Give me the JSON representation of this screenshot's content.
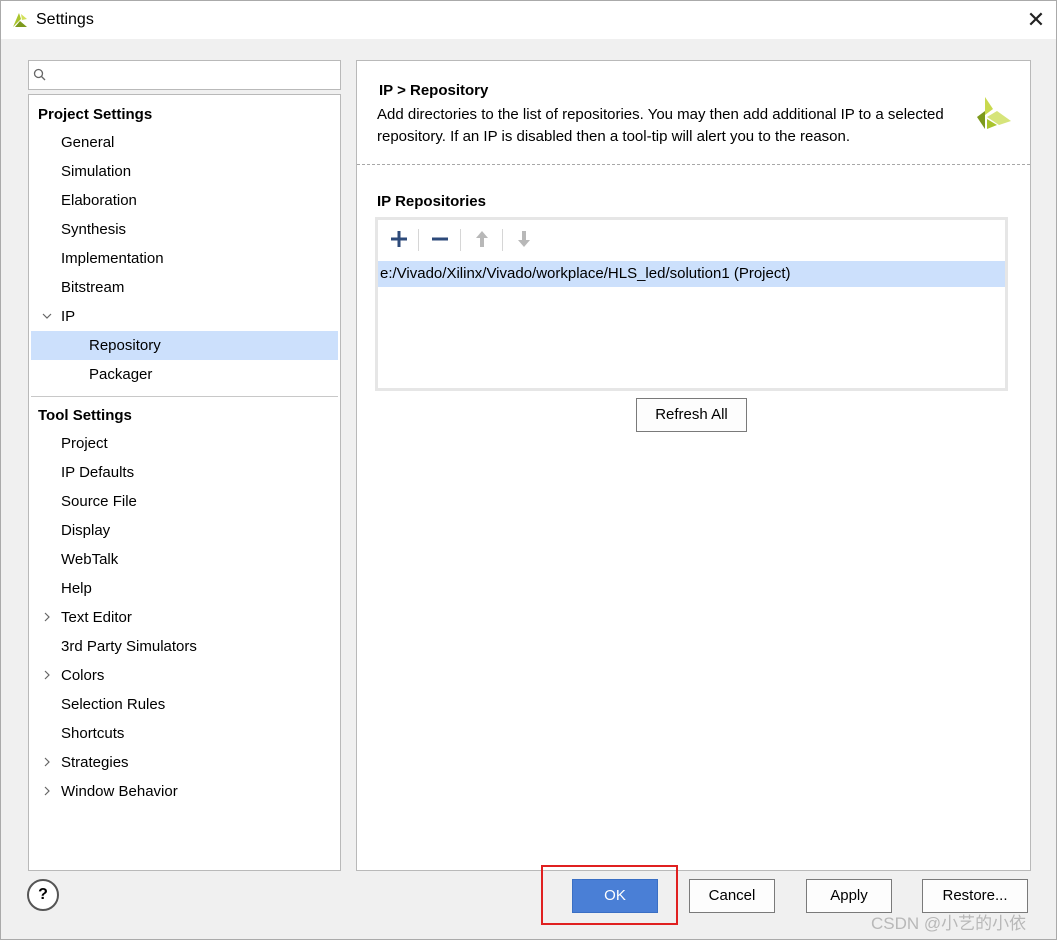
{
  "window": {
    "title": "Settings",
    "close_glyph": "✕"
  },
  "search": {
    "placeholder": "",
    "icon": "search-icon"
  },
  "project_settings": {
    "header": "Project Settings",
    "items": [
      {
        "label": "General"
      },
      {
        "label": "Simulation"
      },
      {
        "label": "Elaboration"
      },
      {
        "label": "Synthesis"
      },
      {
        "label": "Implementation"
      },
      {
        "label": "Bitstream"
      },
      {
        "label": "IP",
        "expanded": true
      },
      {
        "label": "Repository",
        "selected": true
      },
      {
        "label": "Packager"
      }
    ]
  },
  "tool_settings": {
    "header": "Tool Settings",
    "items": [
      {
        "label": "Project"
      },
      {
        "label": "IP Defaults"
      },
      {
        "label": "Source File"
      },
      {
        "label": "Display"
      },
      {
        "label": "WebTalk"
      },
      {
        "label": "Help"
      },
      {
        "label": "Text Editor",
        "expandable": true
      },
      {
        "label": "3rd Party Simulators"
      },
      {
        "label": "Colors",
        "expandable": true
      },
      {
        "label": "Selection Rules"
      },
      {
        "label": "Shortcuts"
      },
      {
        "label": "Strategies",
        "expandable": true
      },
      {
        "label": "Window Behavior",
        "expandable": true
      }
    ]
  },
  "main": {
    "breadcrumb": "IP > Repository",
    "description": "Add directories to the list of repositories. You may then add additional IP to a selected repository. If an IP is disabled then a tool-tip will alert you to the reason.",
    "section_title": "IP Repositories",
    "repositories": [
      {
        "path": "e:/Vivado/Xilinx/Vivado/workplace/HLS_led/solution1 (Project)"
      }
    ],
    "refresh_label": "Refresh All"
  },
  "footer": {
    "help_glyph": "?",
    "ok_label": "OK",
    "cancel_label": "Cancel",
    "apply_label": "Apply",
    "restore_label": "Restore..."
  },
  "watermark": "CSDN @小艺的小依",
  "colors": {
    "accent": "#4a7fd6",
    "selection": "#cce0fc",
    "highlight_box": "#e02020",
    "logo": "#a9c42c"
  }
}
